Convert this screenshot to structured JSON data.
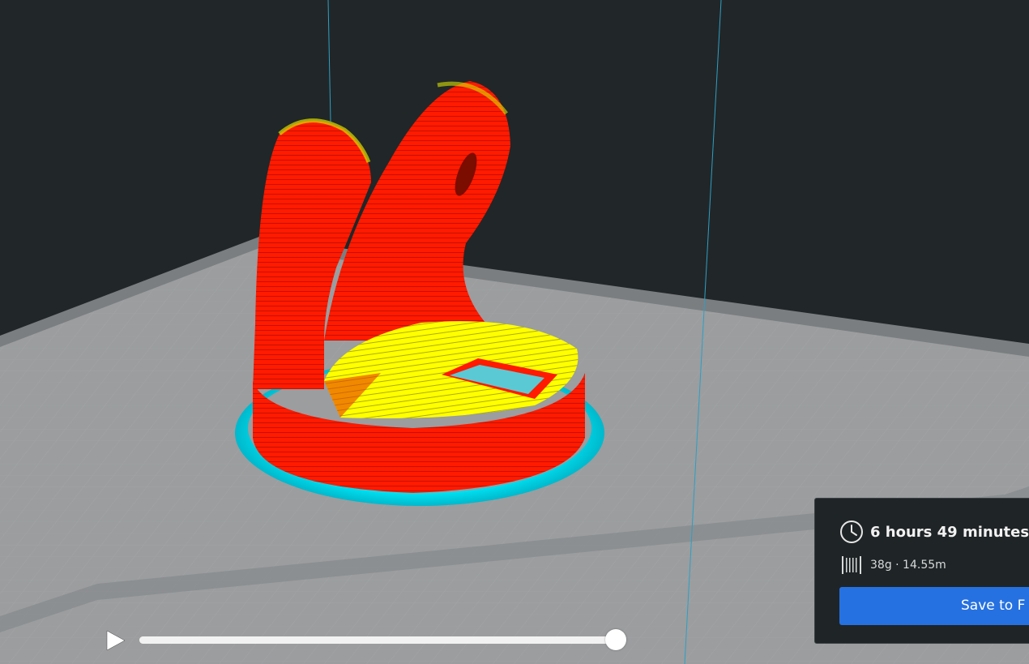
{
  "scene": {
    "background_color": "#212628",
    "build_plate_color": "#9a9c9e",
    "build_volume_line_color": "#2e9fc4",
    "model_wall_color": "#ff1a00",
    "model_top_skin_color": "#ffff00",
    "model_skirt_color": "#00f0ff"
  },
  "playback": {
    "play_icon": "play-icon",
    "progress": 1.0
  },
  "print_info": {
    "time_icon": "clock-icon",
    "print_time": "6 hours 49 minutes",
    "material_icon": "spool-icon",
    "material": "38g · 14.55m",
    "save_label": "Save to F",
    "accent_color": "#2671e1"
  }
}
